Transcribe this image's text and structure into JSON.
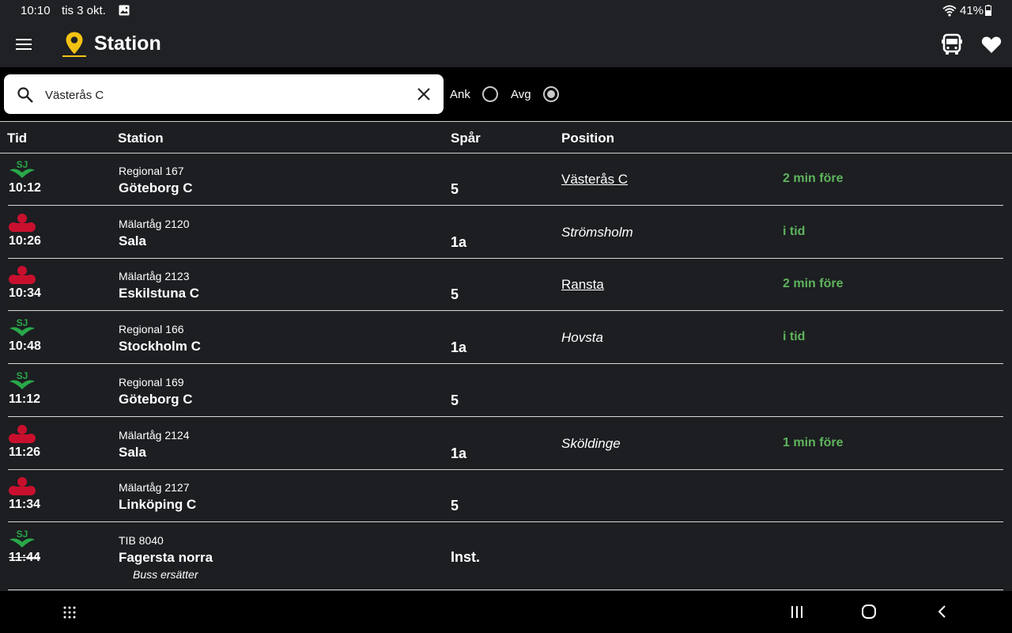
{
  "status_bar": {
    "time": "10:10",
    "date": "tis 3 okt.",
    "battery": "41%"
  },
  "app_bar": {
    "title": "Station"
  },
  "search": {
    "value": "Västerås C"
  },
  "direction": {
    "arrival_label": "Ank",
    "departure_label": "Avg",
    "selected": "Avg"
  },
  "table": {
    "headers": {
      "time": "Tid",
      "station": "Station",
      "track": "Spår",
      "position": "Position"
    },
    "rows": [
      {
        "operator": "sj-logo-icon",
        "time": "10:12",
        "train": "Regional 167",
        "destination": "Göteborg C",
        "note": "",
        "track": "5",
        "position": "Västerås C",
        "position_style": "link",
        "delay": "2 min före",
        "cancelled": false
      },
      {
        "operator": "malartag-logo-icon",
        "time": "10:26",
        "train": "Mälartåg 2120",
        "destination": "Sala",
        "note": "",
        "track": "1a",
        "position": "Strömsholm",
        "position_style": "italic",
        "delay": "i tid",
        "cancelled": false
      },
      {
        "operator": "malartag-logo-icon",
        "time": "10:34",
        "train": "Mälartåg 2123",
        "destination": "Eskilstuna C",
        "note": "",
        "track": "5",
        "position": "Ransta",
        "position_style": "link",
        "delay": "2 min före",
        "cancelled": false
      },
      {
        "operator": "sj-logo-icon",
        "time": "10:48",
        "train": "Regional 166",
        "destination": "Stockholm C",
        "note": "",
        "track": "1a",
        "position": "Hovsta",
        "position_style": "italic",
        "delay": "i tid",
        "cancelled": false
      },
      {
        "operator": "sj-logo-icon",
        "time": "11:12",
        "train": "Regional 169",
        "destination": "Göteborg C",
        "note": "",
        "track": "5",
        "position": "",
        "position_style": "",
        "delay": "",
        "cancelled": false
      },
      {
        "operator": "malartag-logo-icon",
        "time": "11:26",
        "train": "Mälartåg 2124",
        "destination": "Sala",
        "note": "",
        "track": "1a",
        "position": "Sköldinge",
        "position_style": "italic",
        "delay": "1 min före",
        "cancelled": false
      },
      {
        "operator": "malartag-logo-icon",
        "time": "11:34",
        "train": "Mälartåg 2127",
        "destination": "Linköping C",
        "note": "",
        "track": "5",
        "position": "",
        "position_style": "",
        "delay": "",
        "cancelled": false
      },
      {
        "operator": "sj-logo-icon",
        "time": "11:44",
        "train": "TIB 8040",
        "destination": "Fagersta norra",
        "note": "Buss ersätter",
        "track": "Inst.",
        "position": "",
        "position_style": "",
        "delay": "",
        "cancelled": true
      }
    ]
  },
  "colors": {
    "sj_green": "#2aa84a",
    "malartag_red": "#c8102e",
    "delay_green": "#5fb35d",
    "pin_yellow": "#f2c314"
  }
}
